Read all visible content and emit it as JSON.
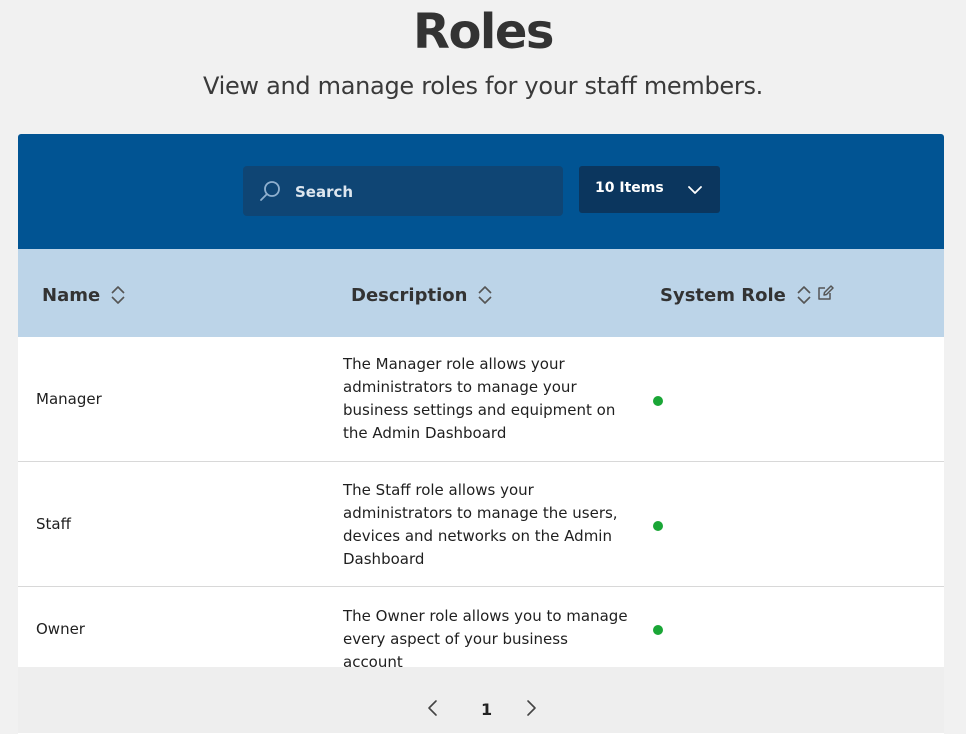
{
  "header": {
    "title": "Roles",
    "subtitle": "View and manage roles for your staff members."
  },
  "toolbar": {
    "search_placeholder": "Search",
    "items_select_label": "10 Items"
  },
  "table": {
    "columns": [
      "Name",
      "Description",
      "System Role"
    ],
    "rows": [
      {
        "name": "Manager",
        "description": "The Manager role allows your administrators to manage your business settings and equipment on the Admin Dashboard",
        "system_role": true
      },
      {
        "name": "Staff",
        "description": "The Staff role allows your administrators to manage the users, devices and networks on the Admin Dashboard",
        "system_role": true
      },
      {
        "name": "Owner",
        "description": "The Owner role allows you to manage every aspect of your business account",
        "system_role": true
      }
    ]
  },
  "pagination": {
    "current_page": "1"
  },
  "colors": {
    "toolbar_bg": "#015493",
    "header_bg": "#bcd4e8",
    "status_dot": "#1aa636"
  }
}
